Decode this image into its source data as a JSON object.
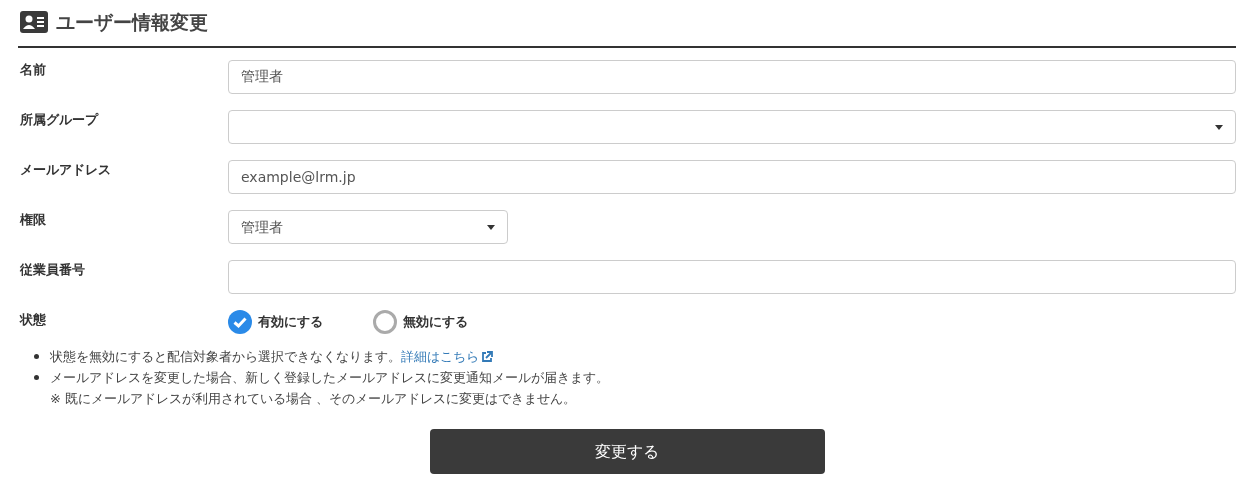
{
  "title": "ユーザー情報変更",
  "fields": [
    {
      "label": "名前",
      "kind": "text",
      "value": "管理者"
    },
    {
      "label": "所属グループ",
      "kind": "select",
      "wide": true
    },
    {
      "label": "メールアドレス",
      "kind": "text",
      "value": "example@lrm.jp"
    },
    {
      "label": "権限",
      "kind": "select",
      "value": "管理者",
      "wide": false
    },
    {
      "label": "従業員番号",
      "kind": "text"
    }
  ],
  "status": {
    "label": "状態",
    "options": [
      {
        "label": "有効にする",
        "selected": true
      },
      {
        "label": "無効にする",
        "selected": false
      }
    ]
  },
  "notes": [
    {
      "text": "状態を無効にすると配信対象者から選択できなくなります。",
      "link": "詳細はこちら"
    },
    {
      "text": "メールアドレスを変更した場合、新しく登録したメールアドレスに変更通知メールが届きます。",
      "subtext": "※ 既にメールアドレスが利用されている場合 、そのメールアドレスに変更はできません。"
    }
  ],
  "submit": "変更する"
}
